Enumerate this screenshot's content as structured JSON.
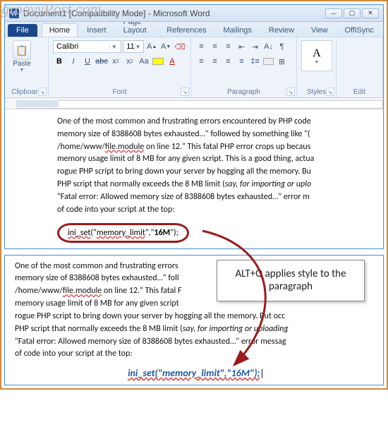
{
  "watermark": "groovyPost.com",
  "title": "Document1 [Compatibility Mode] - Microsoft Word",
  "tabs": {
    "file": "File",
    "home": "Home",
    "insert": "Insert",
    "layout": "Page Layout",
    "refs": "References",
    "mail": "Mailings",
    "review": "Review",
    "view": "View",
    "offi": "OffiSync"
  },
  "ribbon": {
    "paste": "Paste",
    "clipboard": "Clipboard",
    "fontname": "Calibri",
    "fontsize": "11",
    "font_label": "Font",
    "para_label": "Paragraph",
    "styles": "Styles",
    "edit": "Edit"
  },
  "bodytext": {
    "l1": "One of the most common and frustrating errors encountered by PHP code",
    "l2a": "memory size of 8388608 bytes exhausted…\" followed by something like \"(",
    "l3a": "/home/www/",
    "l3b": "file.module",
    "l3c": "  on line 12.\" This fatal PHP error crops up becaus",
    "l4": "memory usage limit of 8 MB for any given script. This is a good thing, actua",
    "l5": "rogue PHP script to bring down your server by hogging all the memory. Bu",
    "l6a": "PHP script that normally exceeds the 8 MB limit (",
    "l6b": "say, for importing or uplo",
    "l7": "\"Fatal error: Allowed memory size of 8388608 bytes exhausted…\" error m",
    "l8": "of code into your script at the top:"
  },
  "code1a": "ini_set",
  "code1b": "(\"",
  "code1c": "memory_limit",
  "code1d": "\",\"",
  "code1e": "16M",
  "code1f": "\");",
  "callout": "ALT+Q applies style to the paragraph",
  "lowerbody": {
    "l1": "One of the most common and frustrating errors",
    "l2": "memory size of 8388608 bytes exhausted…\" foll",
    "l3a": "/home/www/",
    "l3b": "file.module",
    "l3c": "  on line 12.\" This fatal F",
    "l4": "memory usage limit of 8 MB for any given script",
    "l5": "rogue PHP script to bring down your server by hogging all the memory. But occ",
    "l6a": "PHP script that normally exceeds the 8 MB limit (",
    "l6b": "say, for importing or uploading",
    "l7": "\"Fatal error: Allowed memory size of 8388608 bytes exhausted…\" error messag",
    "l8": "of code into your script at the top:"
  },
  "styledcode": "ini_set(\"memory_limit\",\"16M\");"
}
